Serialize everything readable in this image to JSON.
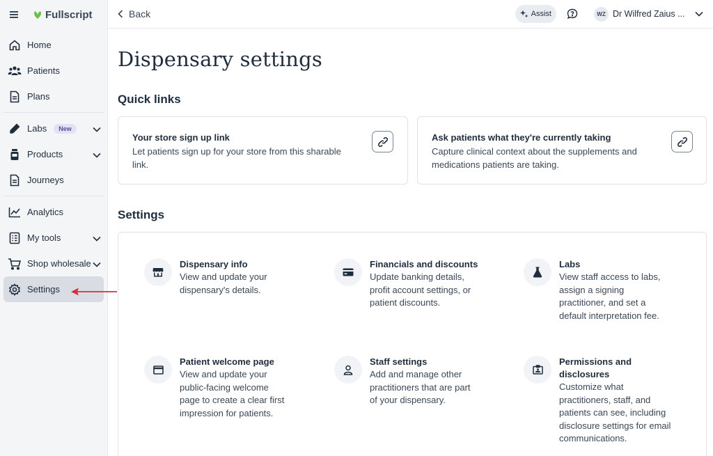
{
  "brand": {
    "name": "Fullscript"
  },
  "sidebar": {
    "groups": [
      [
        {
          "label": "Home",
          "icon": "home-icon"
        },
        {
          "label": "Patients",
          "icon": "patients-icon"
        },
        {
          "label": "Plans",
          "icon": "plans-icon"
        }
      ],
      [
        {
          "label": "Labs",
          "icon": "labs-icon",
          "badge": "New",
          "chevron": true
        },
        {
          "label": "Products",
          "icon": "products-icon",
          "chevron": true
        },
        {
          "label": "Journeys",
          "icon": "journeys-icon"
        }
      ],
      [
        {
          "label": "Analytics",
          "icon": "analytics-icon"
        },
        {
          "label": "My tools",
          "icon": "tools-icon",
          "chevron": true
        },
        {
          "label": "Shop wholesale",
          "icon": "cart-icon",
          "chevron": true
        },
        {
          "label": "Settings",
          "icon": "gear-icon",
          "active": true
        }
      ]
    ]
  },
  "topbar": {
    "back_label": "Back",
    "assist_label": "Assist",
    "avatar_initials": "WZ",
    "user_name": "Dr Wilfred Zaius ..."
  },
  "main": {
    "title": "Dispensary settings",
    "quick_links_title": "Quick links",
    "quick_links": [
      {
        "title": "Your store sign up link",
        "desc_lines": [
          "Let patients sign up for your store from this sharable",
          "link."
        ]
      },
      {
        "title": "Ask patients what they're currently taking",
        "desc_lines": [
          "Capture clinical context about the supplements and",
          "medications patients are taking."
        ]
      }
    ],
    "settings_title": "Settings",
    "settings": [
      {
        "title_lines": [
          "Dispensary info"
        ],
        "desc_lines": [
          "View and update your",
          "dispensary's details."
        ],
        "icon": "store-icon"
      },
      {
        "title_lines": [
          "Financials and discounts"
        ],
        "desc_lines": [
          "Update banking details,",
          "profit account settings, or",
          "patient discounts."
        ],
        "icon": "credit-card-icon"
      },
      {
        "title_lines": [
          "Labs"
        ],
        "desc_lines": [
          "View staff access to labs,",
          "assign a signing",
          "practitioner, and set a",
          "default interpretation fee."
        ],
        "icon": "flask-icon"
      },
      {
        "title_lines": [
          "Patient welcome page"
        ],
        "desc_lines": [
          "View and update your",
          "public-facing welcome",
          "page to create a clear first",
          "impression for patients."
        ],
        "icon": "browser-window-icon"
      },
      {
        "title_lines": [
          "Staff settings"
        ],
        "desc_lines": [
          "Add and manage other",
          "practitioners that are part",
          "of your dispensary."
        ],
        "icon": "person-icon"
      },
      {
        "title_lines": [
          "Permissions and",
          "disclosures"
        ],
        "desc_lines": [
          "Customize what",
          "practitioners, staff, and",
          "patients can see, including",
          "disclosure settings for email",
          "communications."
        ],
        "icon": "id-badge-icon"
      }
    ]
  }
}
